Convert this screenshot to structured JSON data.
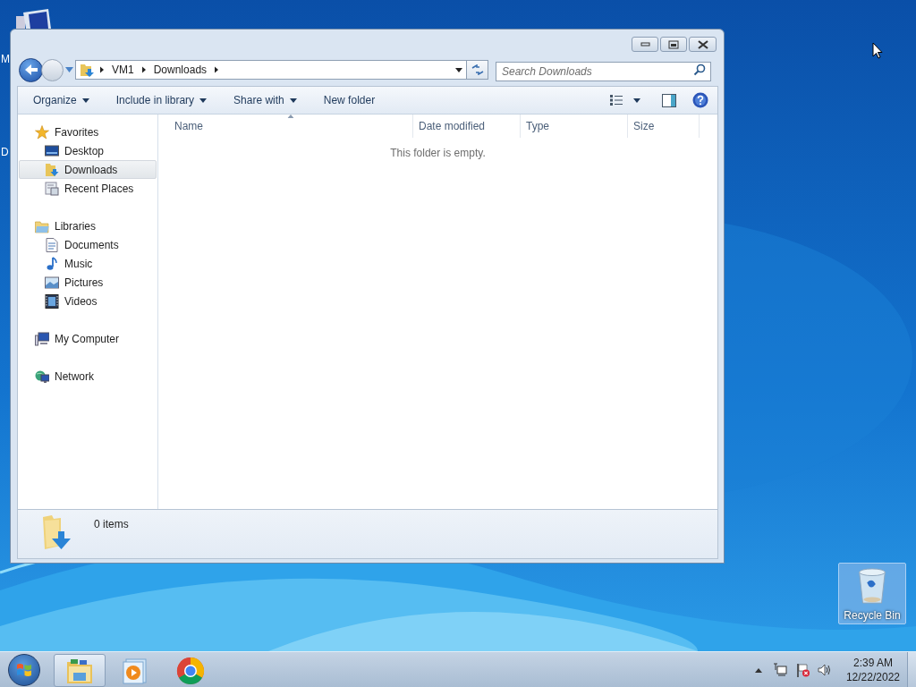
{
  "desktop": {
    "partial_icon_labels": [
      "M",
      "D"
    ],
    "recycle_bin": {
      "label": "Recycle Bin",
      "selected": true
    }
  },
  "window": {
    "address": {
      "breadcrumbs": [
        "VM1",
        "Downloads"
      ]
    },
    "search": {
      "placeholder": "Search Downloads"
    },
    "toolbar": [
      {
        "label": "Organize",
        "dropdown": true
      },
      {
        "label": "Include in library",
        "dropdown": true
      },
      {
        "label": "Share with",
        "dropdown": true
      },
      {
        "label": "New folder",
        "dropdown": false
      }
    ],
    "navigation": [
      {
        "label": "Favorites",
        "selected": false,
        "children": [
          {
            "label": "Desktop",
            "selected": false
          },
          {
            "label": "Downloads",
            "selected": true
          },
          {
            "label": "Recent Places",
            "selected": false
          }
        ]
      },
      {
        "label": "Libraries",
        "selected": false,
        "children": [
          {
            "label": "Documents",
            "selected": false
          },
          {
            "label": "Music",
            "selected": false
          },
          {
            "label": "Pictures",
            "selected": false
          },
          {
            "label": "Videos",
            "selected": false
          }
        ]
      },
      {
        "label": "My Computer",
        "selected": false
      },
      {
        "label": "Network",
        "selected": false
      }
    ],
    "columns": [
      {
        "label": "Name",
        "sorted": true
      },
      {
        "label": "Date modified",
        "sorted": false
      },
      {
        "label": "Type",
        "sorted": false
      },
      {
        "label": "Size",
        "sorted": false
      }
    ],
    "empty_message": "This folder is empty.",
    "status_bar": {
      "item_count": "0 items"
    }
  },
  "taskbar": {
    "items": [
      {
        "kind": "explorer",
        "active": true
      },
      {
        "kind": "media",
        "active": false
      },
      {
        "kind": "browser",
        "active": false
      }
    ],
    "clock": {
      "time": "2:39 AM",
      "date": "12/22/2022"
    }
  }
}
